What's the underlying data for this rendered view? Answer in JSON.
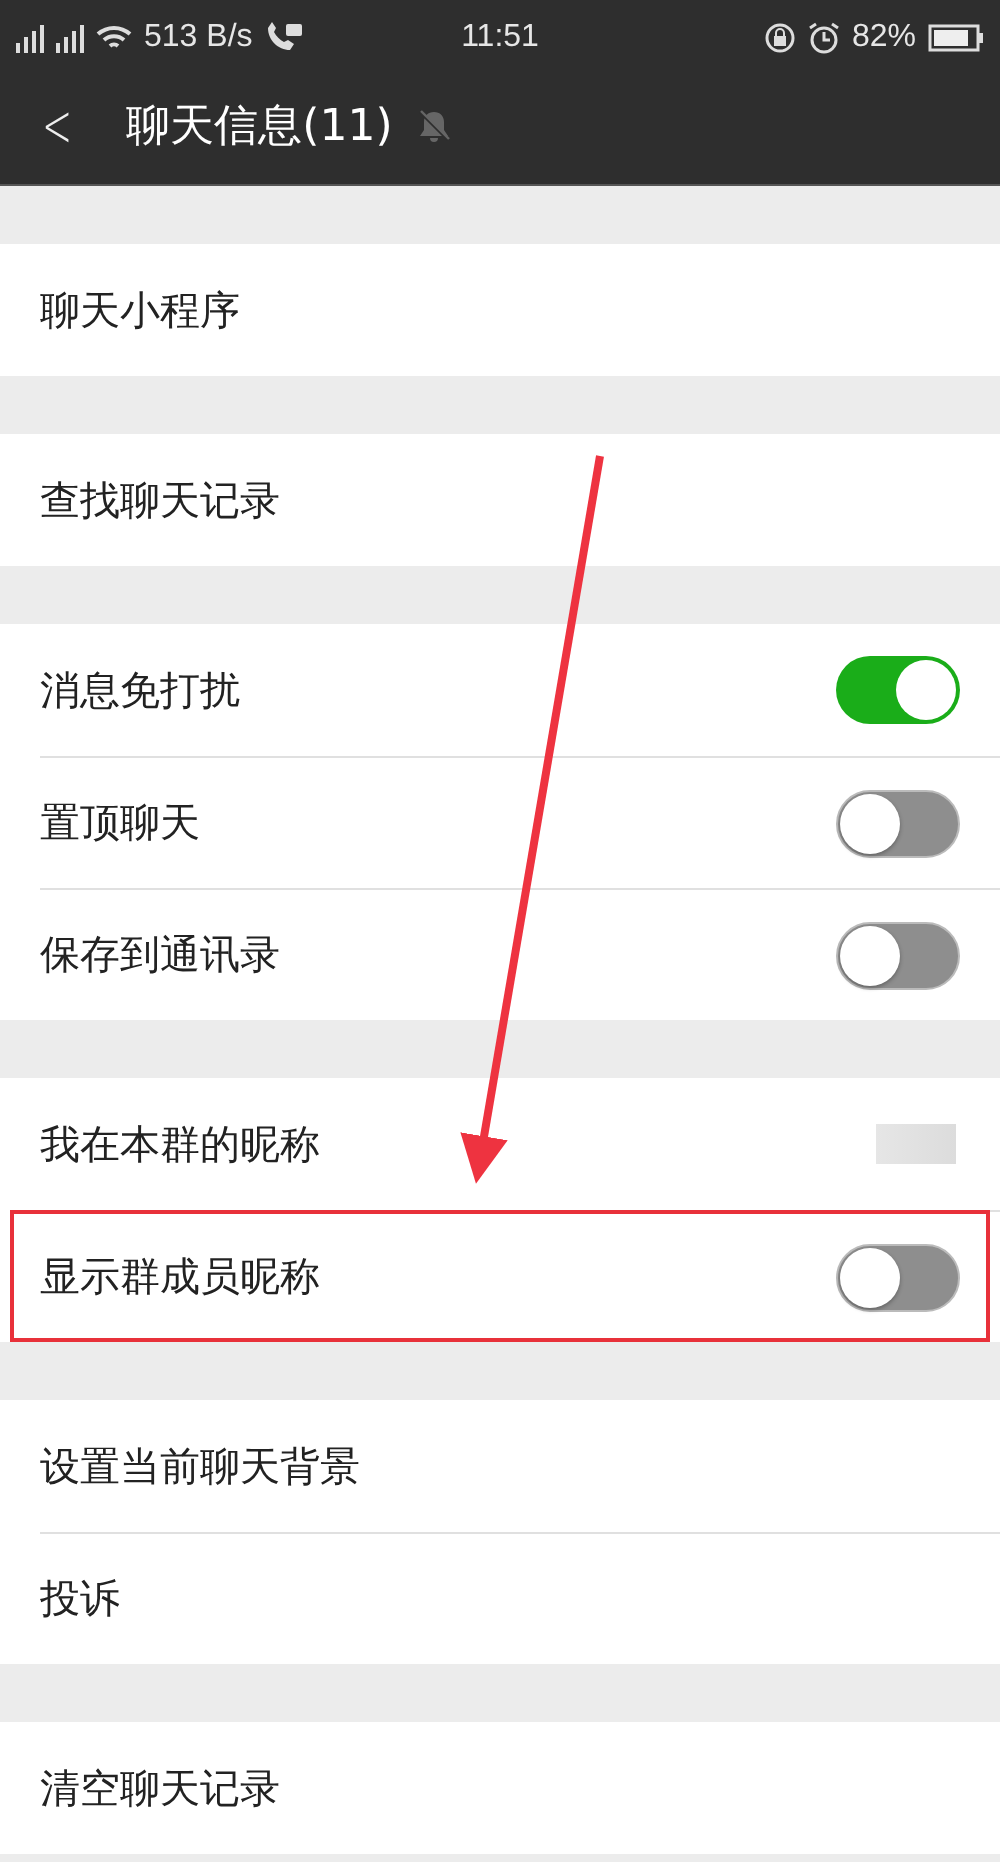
{
  "status_bar": {
    "speed": "513 B/s",
    "time": "11:51",
    "battery": "82%"
  },
  "nav_bar": {
    "back": "<",
    "title": "聊天信息(11)",
    "muted": true
  },
  "groups": [
    {
      "rows": [
        {
          "kind": "plain",
          "label": "聊天小程序"
        }
      ]
    },
    {
      "rows": [
        {
          "kind": "plain",
          "label": "查找聊天记录"
        }
      ]
    },
    {
      "rows": [
        {
          "kind": "toggle",
          "label": "消息免打扰",
          "on": true
        },
        {
          "kind": "toggle",
          "label": "置顶聊天",
          "on": false
        },
        {
          "kind": "toggle",
          "label": "保存到通讯录",
          "on": false
        }
      ]
    },
    {
      "rows": [
        {
          "kind": "value",
          "label": "我在本群的昵称"
        },
        {
          "kind": "toggle",
          "label": "显示群成员昵称",
          "on": false,
          "annotated": true
        }
      ]
    },
    {
      "rows": [
        {
          "kind": "plain",
          "label": "设置当前聊天背景"
        },
        {
          "kind": "plain",
          "label": "投诉"
        }
      ]
    },
    {
      "rows": [
        {
          "kind": "plain",
          "label": "清空聊天记录"
        }
      ]
    }
  ]
}
